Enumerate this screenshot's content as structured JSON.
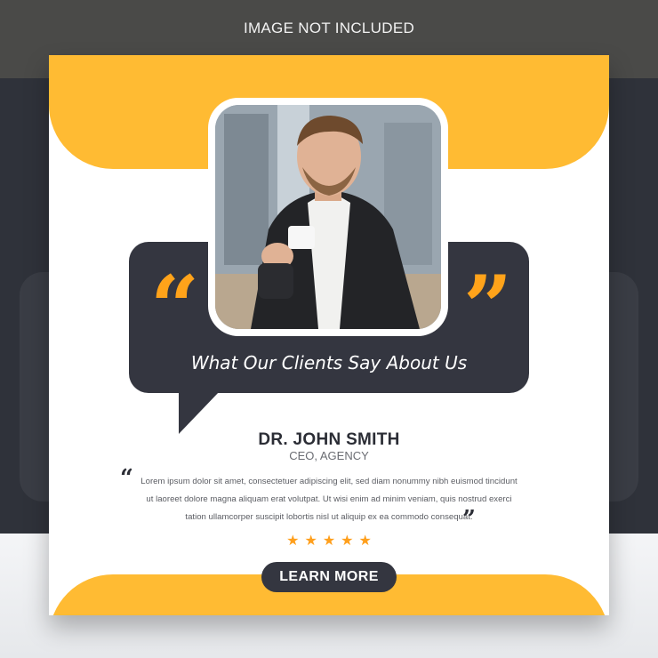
{
  "notice": "IMAGE NOT INCLUDED",
  "bubble": {
    "title": "What Our Clients Say About Us",
    "open_quote": "“",
    "close_quote": "”"
  },
  "testimonial": {
    "name": "DR. JOHN SMITH",
    "role": "CEO, AGENCY",
    "open_quote": "“",
    "close_quote": "”",
    "text": "Lorem ipsum dolor sit amet, consectetuer adipiscing elit, sed diam nonummy nibh euismod tincidunt ut laoreet dolore magna aliquam erat volutpat. Ut wisi enim ad minim veniam, quis nostrud exerci tation ullamcorper suscipit lobortis nisl ut aliquip ex ea commodo consequat.",
    "rating": 5
  },
  "cta": {
    "label": "LEARN MORE"
  },
  "colors": {
    "accent": "#ffbb33",
    "dark": "#343640",
    "quote": "#ffa31a",
    "star": "#ff9f1c"
  },
  "icons": {
    "star": "star-icon",
    "quote_open": "open-quote-icon",
    "quote_close": "close-quote-icon"
  }
}
